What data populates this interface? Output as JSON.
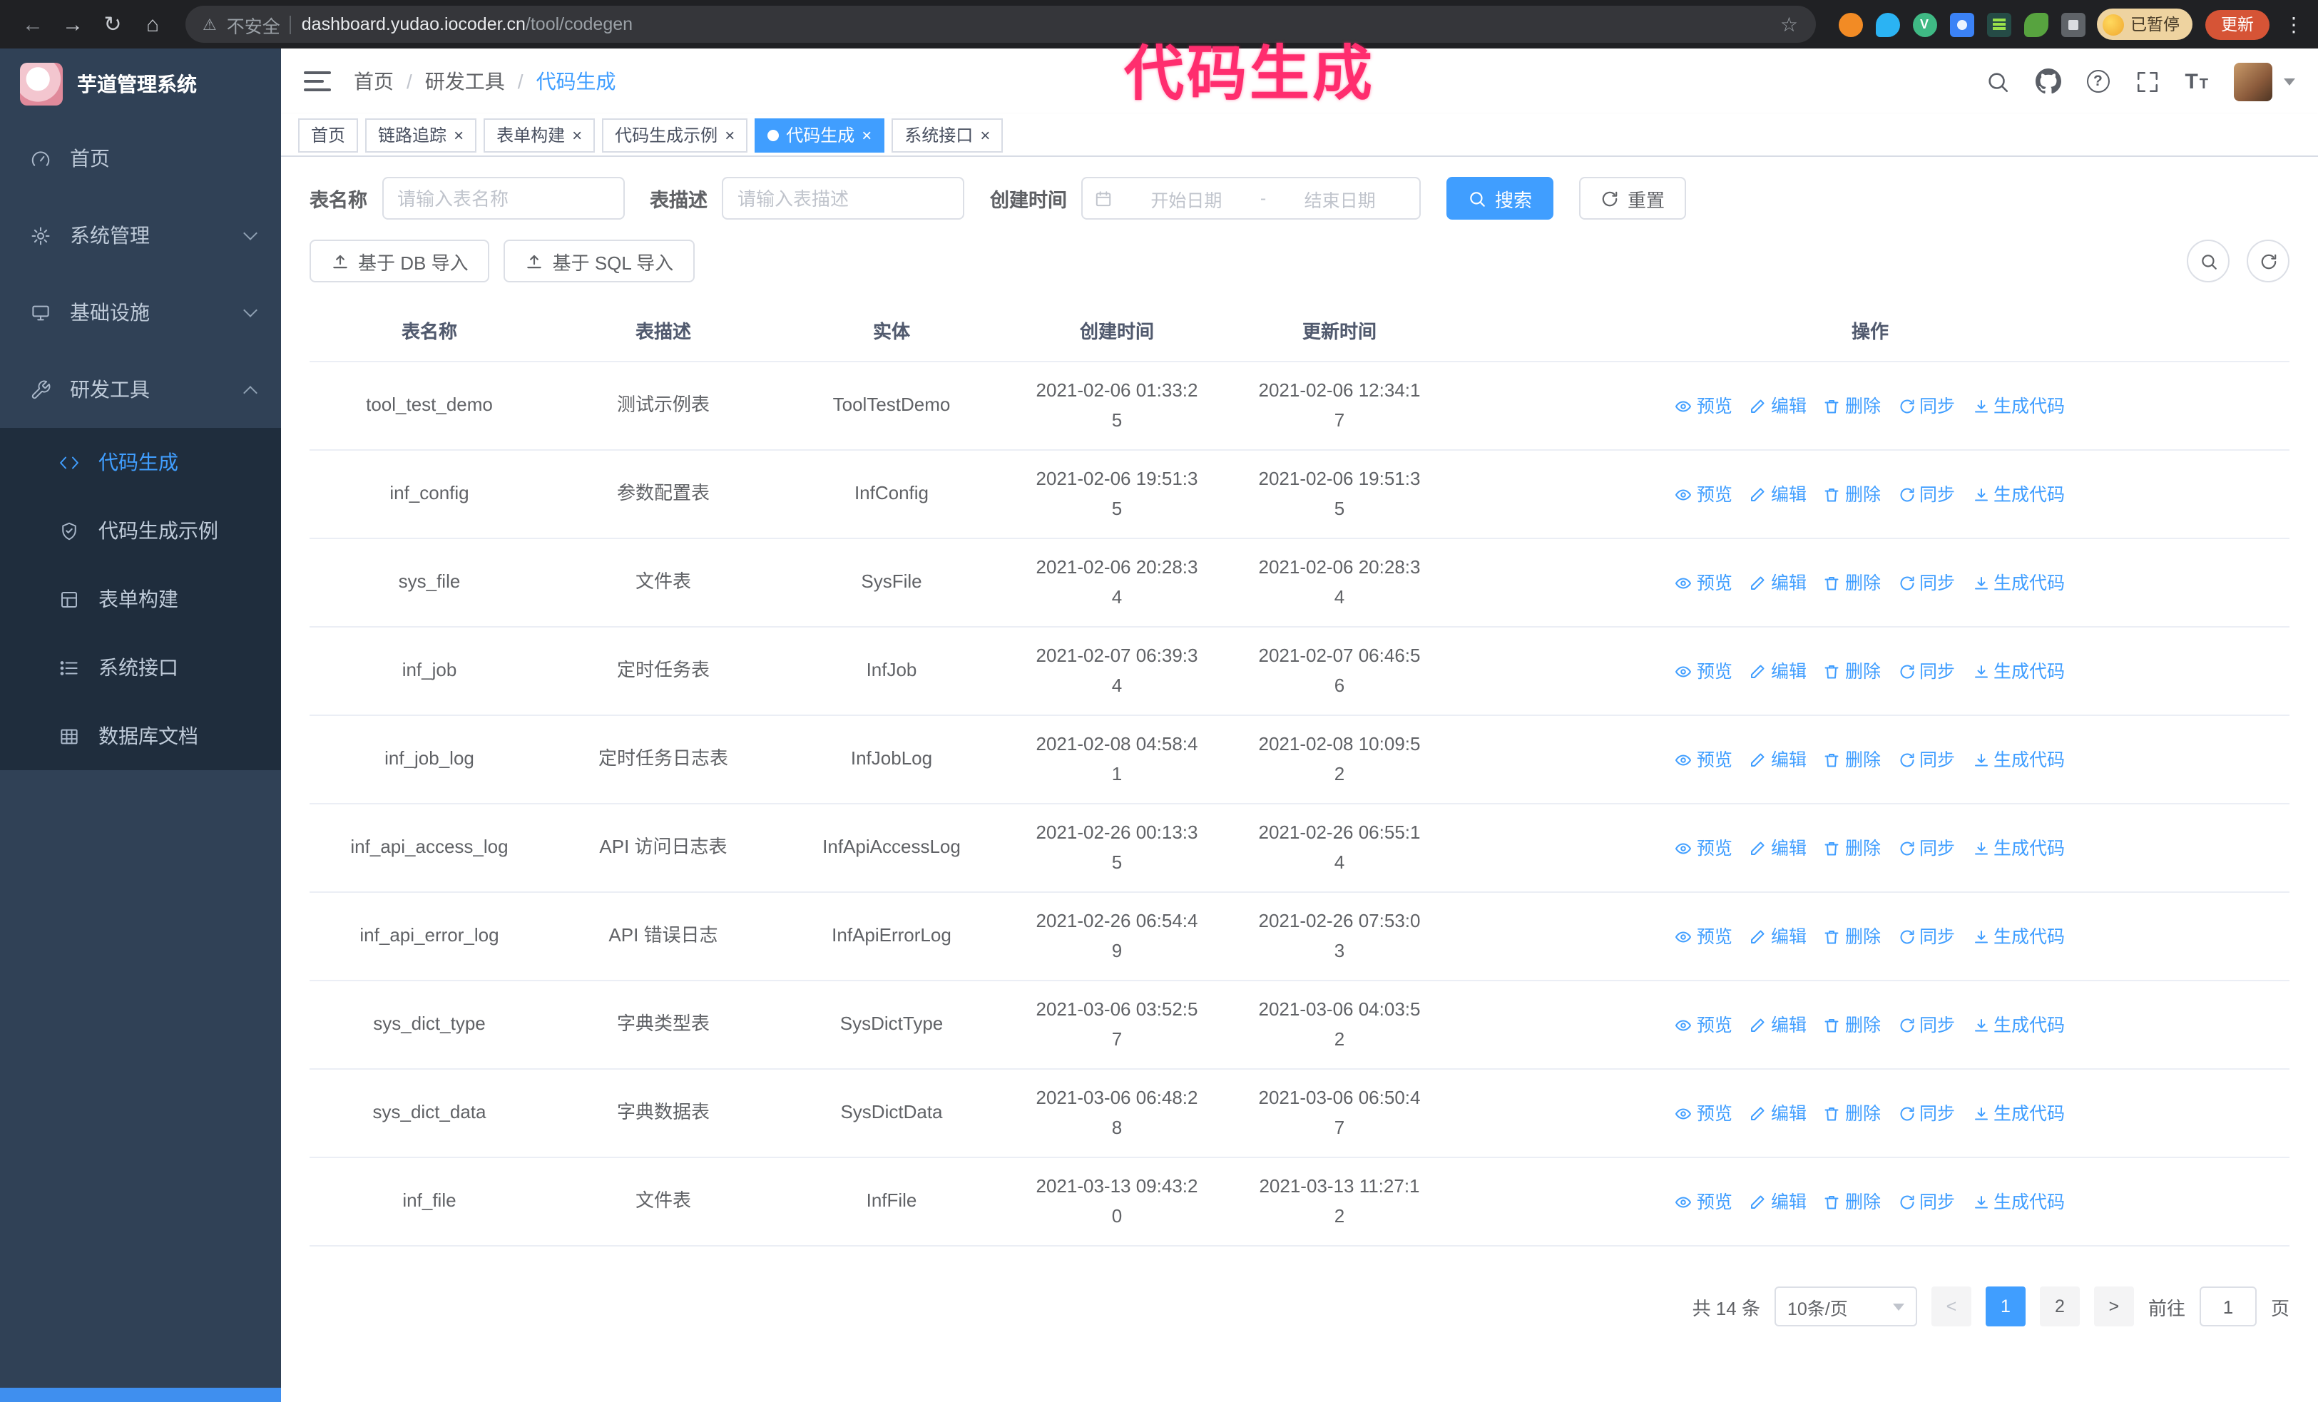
{
  "colors": {
    "accent": "#409eff",
    "sidebar_bg": "#304156",
    "submenu_bg": "#1f2d3d",
    "annotation": "#ff2d6e",
    "chrome_bg": "#202124",
    "update_button_bg": "#d65436"
  },
  "annotation": {
    "text": "代码生成"
  },
  "browser": {
    "security_label": "不安全",
    "url_host": "dashboard.yudao.iocoder.cn",
    "url_path": "/tool/codegen",
    "profile_badge": "已暂停",
    "update_button": "更新"
  },
  "sidebar": {
    "logo_title": "芋道管理系统",
    "items": [
      {
        "label": "首页"
      },
      {
        "label": "系统管理"
      },
      {
        "label": "基础设施"
      },
      {
        "label": "研发工具"
      }
    ],
    "subitems": [
      {
        "label": "代码生成",
        "active": true
      },
      {
        "label": "代码生成示例"
      },
      {
        "label": "表单构建"
      },
      {
        "label": "系统接口"
      },
      {
        "label": "数据库文档"
      }
    ]
  },
  "header": {
    "breadcrumb": [
      "首页",
      "研发工具",
      "代码生成"
    ]
  },
  "tabs": [
    {
      "label": "首页",
      "closable": false,
      "active": false
    },
    {
      "label": "链路追踪",
      "closable": true,
      "active": false
    },
    {
      "label": "表单构建",
      "closable": true,
      "active": false
    },
    {
      "label": "代码生成示例",
      "closable": true,
      "active": false
    },
    {
      "label": "代码生成",
      "closable": true,
      "active": true
    },
    {
      "label": "系统接口",
      "closable": true,
      "active": false
    }
  ],
  "filters": {
    "table_name_label": "表名称",
    "table_name_placeholder": "请输入表名称",
    "table_desc_label": "表描述",
    "table_desc_placeholder": "请输入表描述",
    "create_time_label": "创建时间",
    "date_start_placeholder": "开始日期",
    "date_separator": "-",
    "date_end_placeholder": "结束日期",
    "search_button": "搜索",
    "reset_button": "重置"
  },
  "toolbar": {
    "import_db_button": "基于 DB 导入",
    "import_sql_button": "基于 SQL 导入"
  },
  "table": {
    "columns": [
      "表名称",
      "表描述",
      "实体",
      "创建时间",
      "更新时间",
      "操作"
    ],
    "actions": [
      "预览",
      "编辑",
      "删除",
      "同步",
      "生成代码"
    ],
    "rows": [
      {
        "name": "tool_test_demo",
        "desc": "测试示例表",
        "entity": "ToolTestDemo",
        "created": "2021-02-06 01:33:25",
        "updated": "2021-02-06 12:34:17"
      },
      {
        "name": "inf_config",
        "desc": "参数配置表",
        "entity": "InfConfig",
        "created": "2021-02-06 19:51:35",
        "updated": "2021-02-06 19:51:35"
      },
      {
        "name": "sys_file",
        "desc": "文件表",
        "entity": "SysFile",
        "created": "2021-02-06 20:28:34",
        "updated": "2021-02-06 20:28:34"
      },
      {
        "name": "inf_job",
        "desc": "定时任务表",
        "entity": "InfJob",
        "created": "2021-02-07 06:39:34",
        "updated": "2021-02-07 06:46:56"
      },
      {
        "name": "inf_job_log",
        "desc": "定时任务日志表",
        "entity": "InfJobLog",
        "created": "2021-02-08 04:58:41",
        "updated": "2021-02-08 10:09:52"
      },
      {
        "name": "inf_api_access_log",
        "desc": "API 访问日志表",
        "entity": "InfApiAccessLog",
        "created": "2021-02-26 00:13:35",
        "updated": "2021-02-26 06:55:14"
      },
      {
        "name": "inf_api_error_log",
        "desc": "API 错误日志",
        "entity": "InfApiErrorLog",
        "created": "2021-02-26 06:54:49",
        "updated": "2021-02-26 07:53:03"
      },
      {
        "name": "sys_dict_type",
        "desc": "字典类型表",
        "entity": "SysDictType",
        "created": "2021-03-06 03:52:57",
        "updated": "2021-03-06 04:03:52"
      },
      {
        "name": "sys_dict_data",
        "desc": "字典数据表",
        "entity": "SysDictData",
        "created": "2021-03-06 06:48:28",
        "updated": "2021-03-06 06:50:47"
      },
      {
        "name": "inf_file",
        "desc": "文件表",
        "entity": "InfFile",
        "created": "2021-03-13 09:43:20",
        "updated": "2021-03-13 11:27:12"
      }
    ]
  },
  "pagination": {
    "total_text": "共 14 条",
    "page_size": "10条/页",
    "pages": [
      "1",
      "2"
    ],
    "active_page": "1",
    "goto_label": "前往",
    "goto_value": "1",
    "goto_suffix": "页"
  }
}
